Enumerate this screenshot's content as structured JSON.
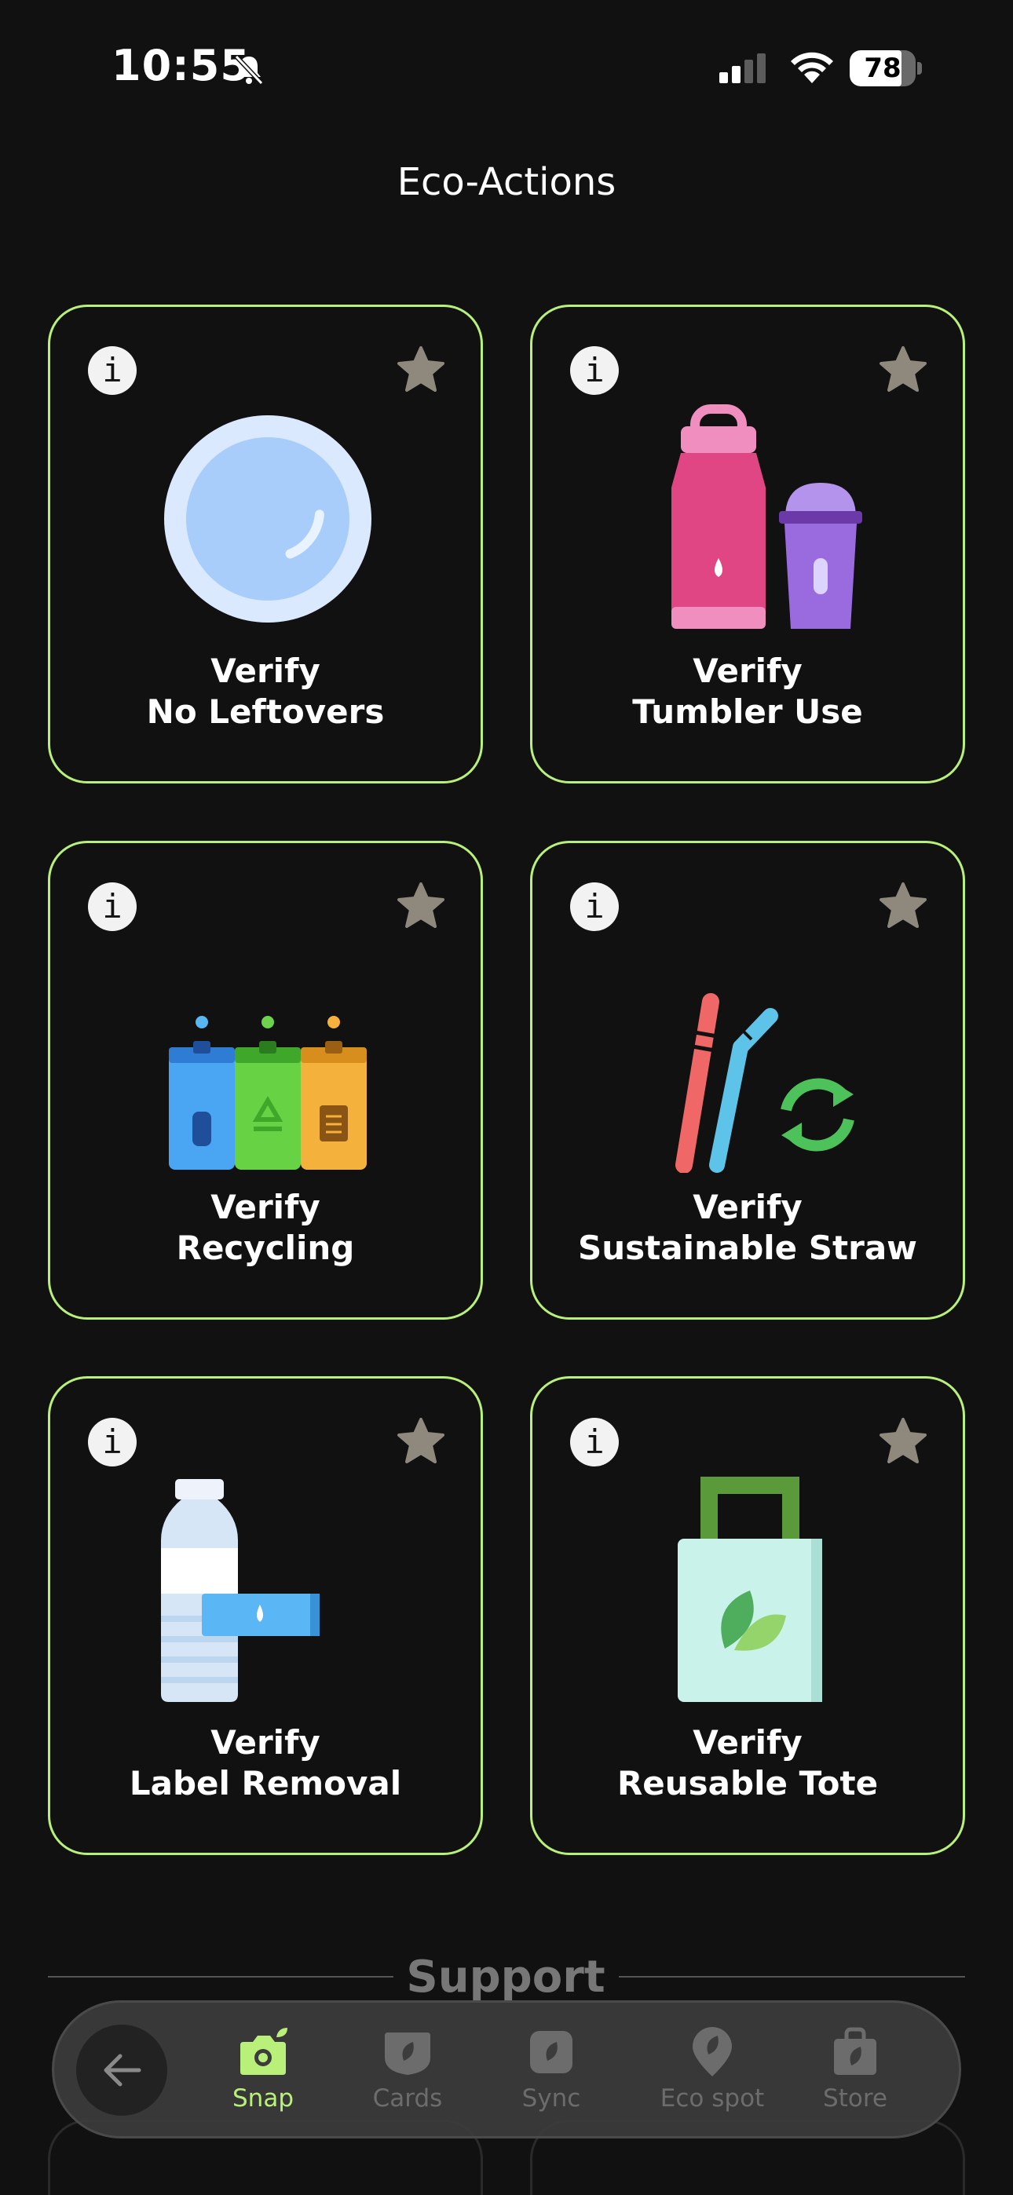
{
  "status_bar": {
    "time": "10:55",
    "battery_level": "78",
    "battery_fraction": 0.78,
    "icons": [
      "bell-slash-icon",
      "signal-icon",
      "wifi-icon",
      "battery-icon"
    ]
  },
  "header": {
    "title": "Eco-Actions"
  },
  "cards": [
    {
      "line1": "Verify",
      "line2": "No Leftovers",
      "icon": "plate-icon"
    },
    {
      "line1": "Verify",
      "line2": "Tumbler Use",
      "icon": "tumbler-icon"
    },
    {
      "line1": "Verify",
      "line2": "Recycling",
      "icon": "recycling-bins-icon"
    },
    {
      "line1": "Verify",
      "line2": "Sustainable Straw",
      "icon": "straw-icon"
    },
    {
      "line1": "Verify",
      "line2": "Label Removal",
      "icon": "bottle-label-icon"
    },
    {
      "line1": "Verify",
      "line2": "Reusable Tote",
      "icon": "tote-bag-icon"
    }
  ],
  "card_controls": {
    "info_glyph": "i",
    "info_icon": "info-icon",
    "favorite_icon": "star-icon"
  },
  "support": {
    "title": "Support"
  },
  "bottom_nav": {
    "items": [
      {
        "label": "Snap",
        "icon": "camera-icon",
        "active": true
      },
      {
        "label": "Cards",
        "icon": "cards-icon",
        "active": false
      },
      {
        "label": "Sync",
        "icon": "sync-icon",
        "active": false
      },
      {
        "label": "Eco spot",
        "icon": "map-pin-icon",
        "active": false
      },
      {
        "label": "Store",
        "icon": "shopping-bag-icon",
        "active": false
      }
    ]
  },
  "colors": {
    "background": "#111111",
    "accent": "#b9f07a",
    "inactive": "#6c6c6c",
    "star": "#8f887c"
  }
}
